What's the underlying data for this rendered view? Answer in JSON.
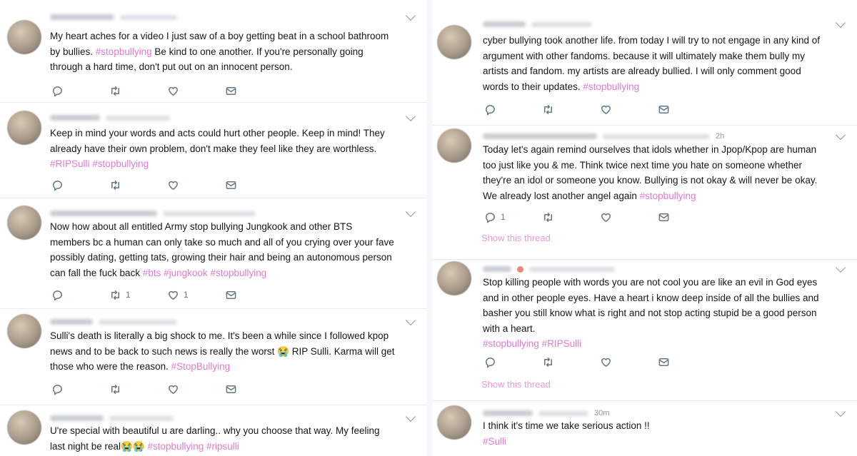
{
  "left_column": [
    {
      "time": "",
      "lines": [
        [
          {
            "t": "My heart aches for a video I just saw of a boy getting beat in a school bathroom"
          }
        ],
        [
          {
            "t": "by bullies. "
          },
          {
            "t": "#stopbullying",
            "tag": true
          },
          {
            "t": " Be kind to one another. If you're personally going"
          }
        ],
        [
          {
            "t": "through a hard time, don't put out on an innocent person."
          }
        ]
      ],
      "replies": "",
      "retweets": "",
      "likes": ""
    },
    {
      "time": "",
      "lines": [
        [
          {
            "t": "Keep in mind your words and acts could hurt other people. Keep in mind! They"
          }
        ],
        [
          {
            "t": "already have their own problem, don't make they feel like they are worthless."
          }
        ],
        [
          {
            "t": "#RIPSulli",
            "tag": true
          },
          {
            "t": " "
          },
          {
            "t": "#stopbullying",
            "tag": true
          }
        ]
      ],
      "replies": "",
      "retweets": "",
      "likes": ""
    },
    {
      "time": "",
      "lines": [
        [
          {
            "t": "Now how about all entitled Army stop bullying Jungkook and other BTS"
          }
        ],
        [
          {
            "t": "members bc a human can only take so much and all of you crying over your fave"
          }
        ],
        [
          {
            "t": "possibly dating, getting tats, growing their hair and being an autonomous person"
          }
        ],
        [
          {
            "t": "can fall the fuck back "
          },
          {
            "t": "#bts",
            "tag": true
          },
          {
            "t": " "
          },
          {
            "t": "#jungkook",
            "tag": true
          },
          {
            "t": " "
          },
          {
            "t": "#stopbullying",
            "tag": true
          }
        ]
      ],
      "replies": "",
      "retweets": "1",
      "likes": "1"
    },
    {
      "time": "",
      "lines": [
        [
          {
            "t": "Sulli's death is literally a big shock to me. It's been a while since I followed kpop"
          }
        ],
        [
          {
            "t": "news and to be back to such news is really the worst 😭 RIP Sulli. Karma will get"
          }
        ],
        [
          {
            "t": "those who were the reason. "
          },
          {
            "t": "#StopBullying",
            "tag": true
          }
        ]
      ],
      "replies": "",
      "retweets": "",
      "likes": ""
    },
    {
      "time": "",
      "lines": [
        [
          {
            "t": "U're special with beautiful u are darling.. why you choose that way. My feeling"
          }
        ],
        [
          {
            "t": "last night be real😭😭 "
          },
          {
            "t": "#stopbullying",
            "tag": true
          },
          {
            "t": " "
          },
          {
            "t": "#ripsulli",
            "tag": true
          }
        ]
      ],
      "replies": "",
      "retweets": "",
      "likes": ""
    }
  ],
  "right_column": [
    {
      "time": "",
      "lines": [
        [
          {
            "t": "cyber bullying took another life. from today I will try to not engage in any kind of"
          }
        ],
        [
          {
            "t": "argument with other fandoms. because it will ultimately make them bully my"
          }
        ],
        [
          {
            "t": "artists and fandom. my artists are already bullied. I will only comment good"
          }
        ],
        [
          {
            "t": "words to their updates. "
          },
          {
            "t": "#stopbullying",
            "tag": true
          }
        ]
      ],
      "replies": "",
      "retweets": "",
      "likes": "",
      "thread": ""
    },
    {
      "time": "2h",
      "lines": [
        [
          {
            "t": "Today let's again remind ourselves that idols whether in Jpop/Kpop are human"
          }
        ],
        [
          {
            "t": "too just like you & me. Think twice next time you hate on someone whether"
          }
        ],
        [
          {
            "t": "they're an idol or someone you know. Bullying is not okay & will never be okay."
          }
        ],
        [
          {
            "t": "We already lost another angel again "
          },
          {
            "t": "#stopbullying",
            "tag": true
          }
        ]
      ],
      "replies": "1",
      "retweets": "",
      "likes": "",
      "thread": "Show this thread"
    },
    {
      "time": "",
      "lines": [
        [
          {
            "t": "Stop killing people with words you are not cool you are like an evil in God eyes"
          }
        ],
        [
          {
            "t": "and in other people eyes. Have a heart i know deep inside of all the bullies and"
          }
        ],
        [
          {
            "t": "basher you still know what is right and not stop acting stupid be a good person"
          }
        ],
        [
          {
            "t": "with a heart."
          }
        ],
        [
          {
            "t": "#stopbullying",
            "tag": true
          },
          {
            "t": " "
          },
          {
            "t": "#RIPSulli",
            "tag": true
          }
        ]
      ],
      "replies": "",
      "retweets": "",
      "likes": "",
      "thread": "Show this thread"
    },
    {
      "time": "30m",
      "lines": [
        [
          {
            "t": "I think it's time we take serious action !!"
          }
        ],
        [
          {
            "t": "#Sulli",
            "tag": true
          }
        ]
      ],
      "replies": "",
      "retweets": "",
      "likes": "",
      "thread": ""
    }
  ],
  "icons": [
    "reply-icon",
    "retweet-icon",
    "like-icon",
    "message-icon",
    "chevron-down-icon"
  ],
  "colors": {
    "hashtag": "#e07ad0",
    "thread_link": "#e69ad8",
    "muted": "#657786",
    "divider": "#e6ecf0"
  }
}
